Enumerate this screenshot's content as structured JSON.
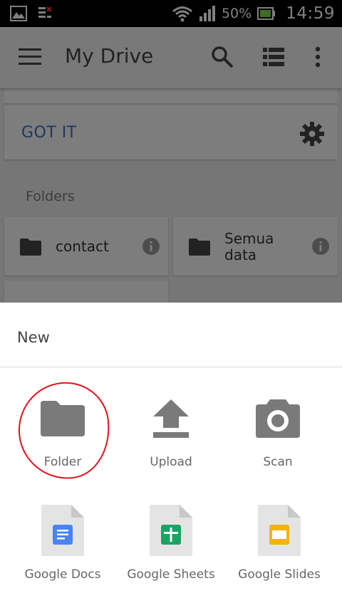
{
  "status_bar": {
    "battery_percent": "50%",
    "time": "14:59"
  },
  "toolbar": {
    "title": "My Drive"
  },
  "background": {
    "banner_action": "GOT IT",
    "section_title": "Folders",
    "folders": [
      {
        "name_line1": "contact",
        "name_line2": ""
      },
      {
        "name_line1": "Semua",
        "name_line2": "data"
      }
    ]
  },
  "sheet": {
    "title": "New",
    "options": [
      {
        "label": "Folder",
        "icon": "folder-icon"
      },
      {
        "label": "Upload",
        "icon": "upload-icon"
      },
      {
        "label": "Scan",
        "icon": "camera-icon"
      },
      {
        "label": "Google Docs",
        "icon": "google-docs-icon"
      },
      {
        "label": "Google Sheets",
        "icon": "google-sheets-icon"
      },
      {
        "label": "Google Slides",
        "icon": "google-slides-icon"
      }
    ]
  },
  "colors": {
    "accent_blue": "#3f6fc5",
    "docs_blue": "#4a84f1",
    "sheets_green": "#19a463",
    "slides_yellow": "#f5b400",
    "highlight_red": "#e8101a",
    "icon_grey": "#7a7a7a"
  }
}
